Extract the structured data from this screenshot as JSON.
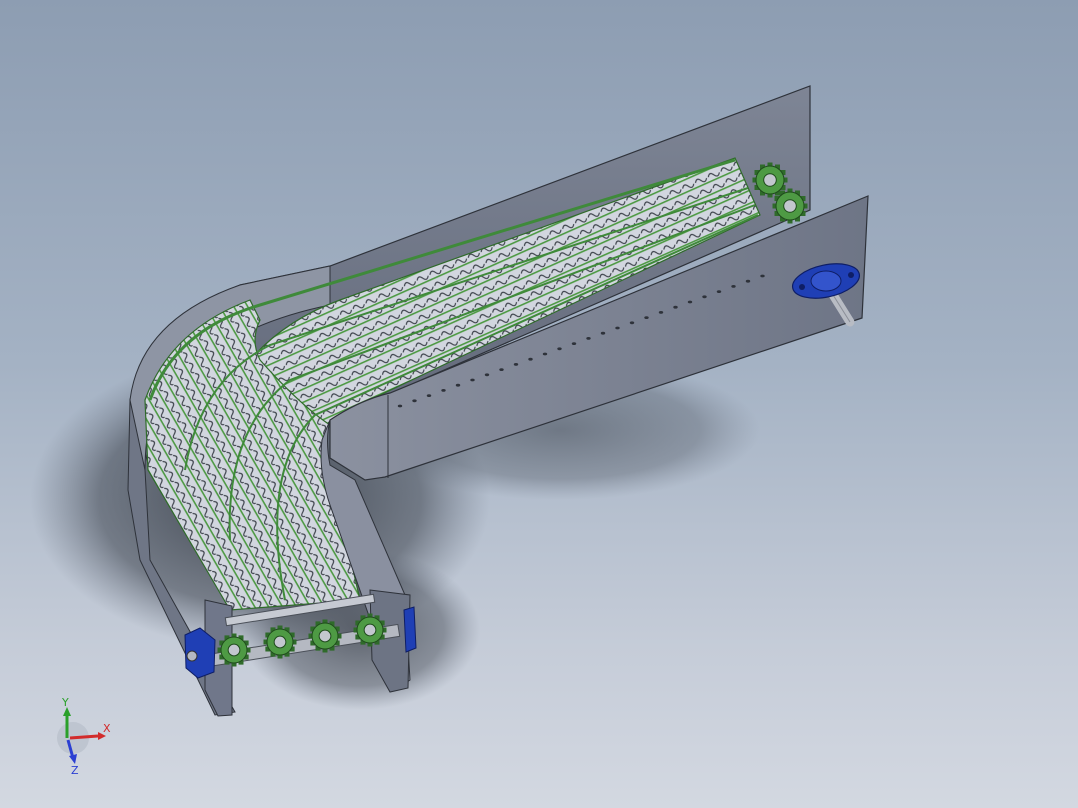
{
  "view": {
    "background_top": "#8d9db2",
    "background_bottom": "#d3d8e1"
  },
  "model": {
    "frame_color": "#7b8292",
    "belt_color": "#c9ced8",
    "chain_color": "#3f8a3a",
    "bearing_color": "#1f3fb5",
    "shaft_color": "#b5b9c2"
  },
  "triad": {
    "x_label": "X",
    "y_label": "Y",
    "z_label": "Z",
    "x_color": "#d22b2b",
    "y_color": "#2aa02a",
    "z_color": "#2b3fd2"
  }
}
